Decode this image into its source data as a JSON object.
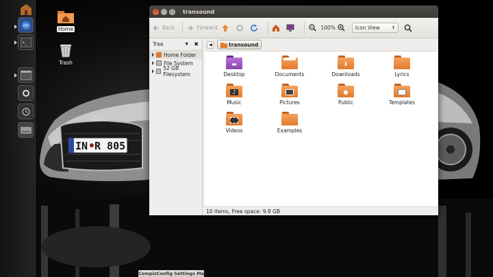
{
  "desktop": {
    "icons": [
      {
        "label": "Home"
      },
      {
        "label": "Trash"
      }
    ],
    "taskbar_item": "CompizConfig Settings Manager"
  },
  "window": {
    "title": "transound",
    "toolbar": {
      "back_label": "Back",
      "forward_label": "Forward",
      "zoom_level": "100%",
      "view_mode": "Icon View"
    },
    "sidebar": {
      "mode": "Tree",
      "items": [
        {
          "label": "Home Folder"
        },
        {
          "label": "File System"
        },
        {
          "label": "52 GB Filesystem"
        }
      ]
    },
    "path": {
      "current": "transound"
    },
    "files": [
      {
        "name": "Desktop",
        "icon": "desktop-folder-icon"
      },
      {
        "name": "Documents",
        "icon": "documents-folder-icon"
      },
      {
        "name": "Downloads",
        "icon": "downloads-folder-icon"
      },
      {
        "name": "Lyrics",
        "icon": "folder-icon"
      },
      {
        "name": "Music",
        "icon": "music-folder-icon"
      },
      {
        "name": "Pictures",
        "icon": "pictures-folder-icon"
      },
      {
        "name": "Public",
        "icon": "public-folder-icon"
      },
      {
        "name": "Templates",
        "icon": "templates-folder-icon"
      },
      {
        "name": "Videos",
        "icon": "videos-folder-icon"
      },
      {
        "name": "Examples",
        "icon": "folder-icon"
      }
    ],
    "status": "10 items, Free space: 9.8 GB"
  },
  "colors": {
    "folder_orange": "#e8873d",
    "titlebar": "#3c3b37",
    "launcher_bg": "#1e1e1e"
  }
}
